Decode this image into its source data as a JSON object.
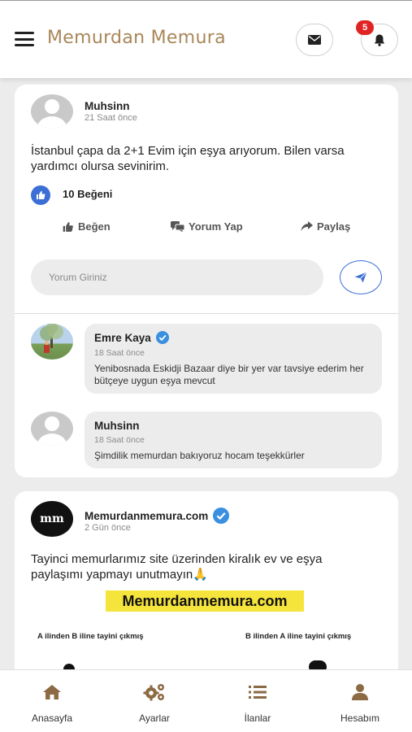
{
  "header": {
    "app_title": "Memurdan Memura",
    "notification_count": "5"
  },
  "post1": {
    "author": "Muhsinn",
    "time": "21 Saat önce",
    "text": "İstanbul çapa da 2+1 Evim için eşya arıyorum. Bilen varsa yardımcı olursa sevinirim.",
    "likes": "10 Beğeni",
    "actions": {
      "like": "Beğen",
      "comment": "Yorum Yap",
      "share": "Paylaş"
    },
    "comment_placeholder": "Yorum Giriniz",
    "comments": [
      {
        "author": "Emre Kaya",
        "time": "18 Saat önce",
        "text": "Yenibosnada Eskidji Bazaar diye bir yer var tavsiye ederim her bütçeye uygun eşya mevcut"
      },
      {
        "author": "Muhsinn",
        "time": "18 Saat önce",
        "text": "Şimdilik memurdan bakıyoruz hocam teşekkürler"
      }
    ]
  },
  "post2": {
    "author": "Memurdanmemura.com",
    "avatar_text": "mm",
    "time": "2 Gün önce",
    "text": "Tayinci memurlarımız site üzerinden kiralık ev ve eşya paylaşımı yapmayı unutmayın🙏",
    "banner": "Memurdanmemura.com",
    "info_left": "A ilinden B iline tayini çıkmış",
    "info_right": "B ilinden A iline tayini çıkmış"
  },
  "nav": [
    {
      "label": "Anasayfa",
      "icon": "home-icon"
    },
    {
      "label": "Ayarlar",
      "icon": "gears-icon"
    },
    {
      "label": "İlanlar",
      "icon": "list-icon"
    },
    {
      "label": "Hesabım",
      "icon": "user-icon"
    }
  ],
  "colors": {
    "brand": "#a9875a",
    "accent_blue": "#3b6fd6",
    "badge_red": "#e02424",
    "banner_yellow": "#f5e43c",
    "nav_icon": "#8b6a44"
  }
}
